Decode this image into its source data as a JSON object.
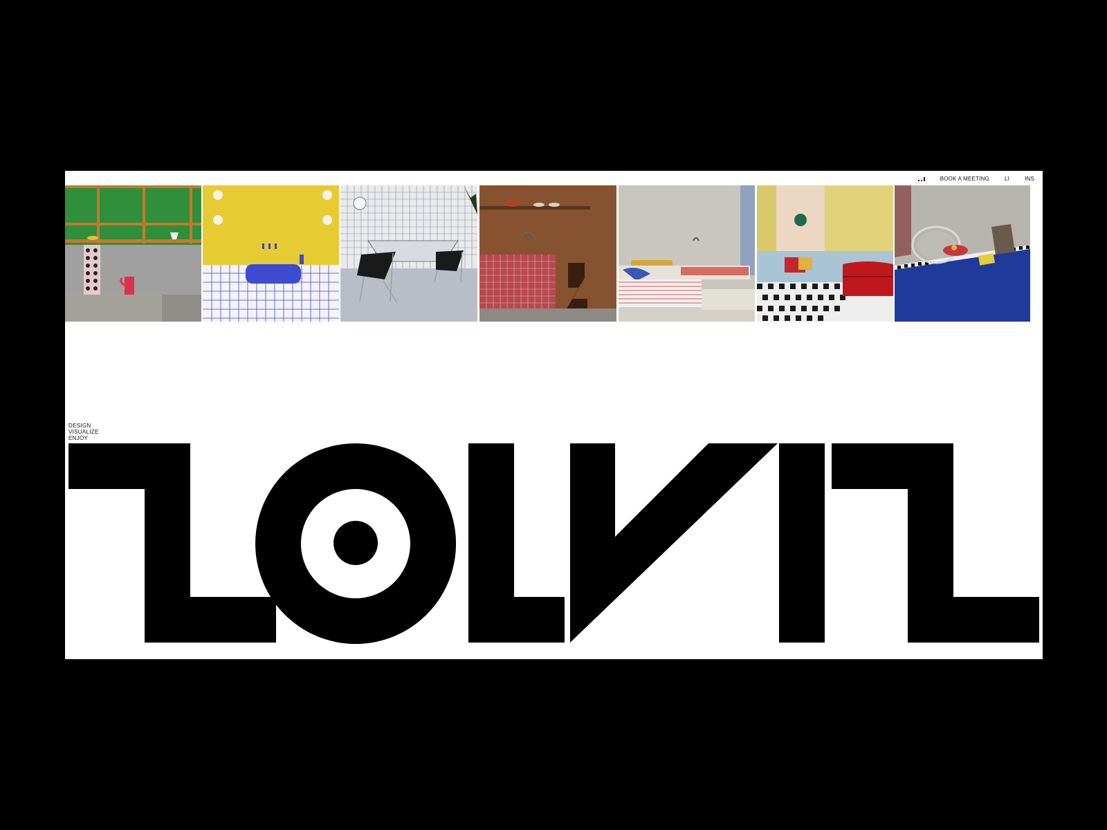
{
  "nav": {
    "book_meeting": "BOOK A MEETING",
    "linkedin": "LI",
    "instagram": "INS",
    "signal_icon": "signal-bars-icon"
  },
  "gallery": {
    "tiles": [
      {
        "name": "gallery-tile-green-shelf-kitchen"
      },
      {
        "name": "gallery-tile-yellow-bathroom-sink"
      },
      {
        "name": "gallery-tile-grid-tile-chairs"
      },
      {
        "name": "gallery-tile-brown-kitchen"
      },
      {
        "name": "gallery-tile-bedroom"
      },
      {
        "name": "gallery-tile-checker-floor-sofa"
      },
      {
        "name": "gallery-tile-blue-floor-chair"
      }
    ]
  },
  "tagline": {
    "line1": "DESIGN",
    "line2": "VISUALIZE",
    "line3": "ENJOY"
  },
  "brand": {
    "logo": "ZOLVIZ",
    "colors": {
      "background": "#000000",
      "page": "#ffffff",
      "ink": "#000000"
    }
  }
}
